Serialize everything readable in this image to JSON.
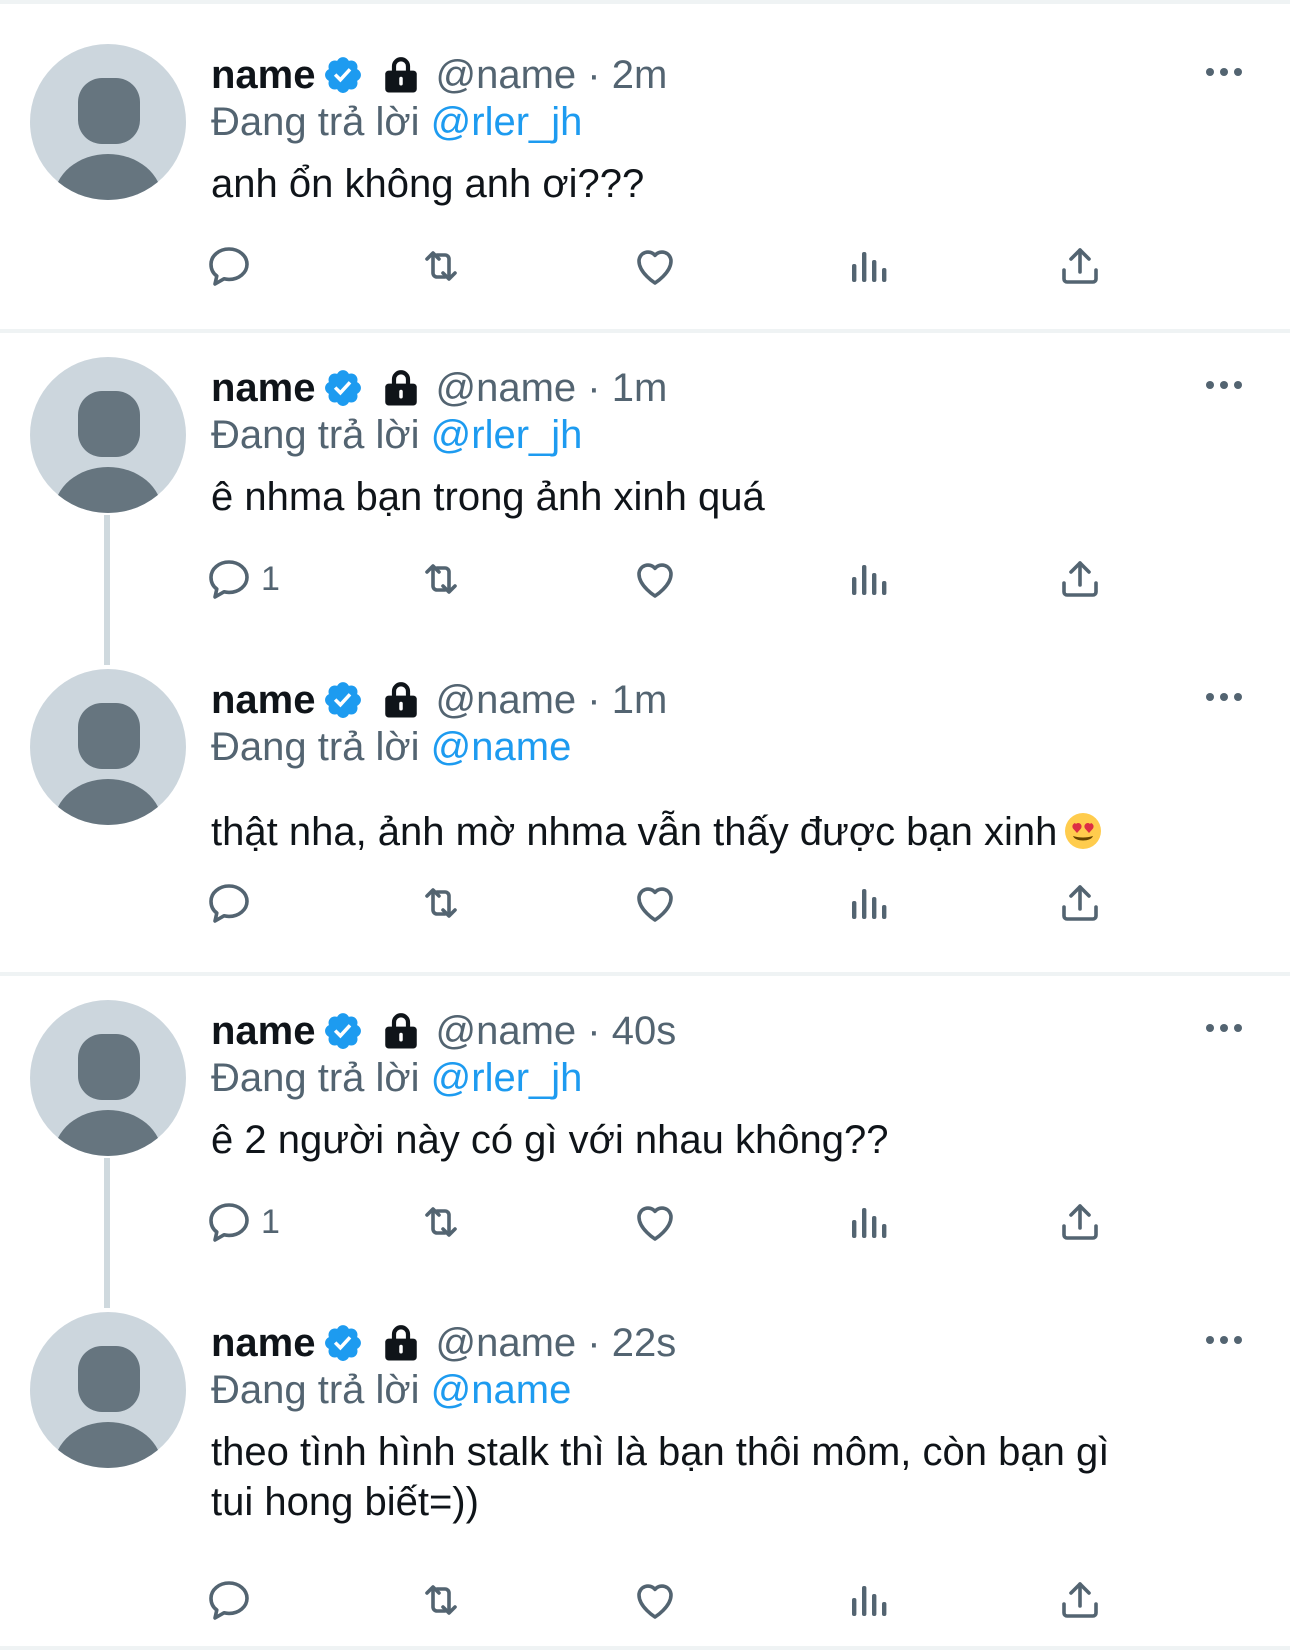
{
  "tweets": [
    {
      "name": "name",
      "handle_time": "@name · 2m",
      "reply_prefix": "Đang trả lời",
      "reply_mention": "@rler_jh",
      "text": "anh ổn không anh ơi???",
      "reply_count": ""
    },
    {
      "name": "name",
      "handle_time": "@name · 1m",
      "reply_prefix": "Đang trả lời",
      "reply_mention": "@rler_jh",
      "text": "ê nhma bạn trong ảnh xinh quá",
      "reply_count": "1"
    },
    {
      "name": "name",
      "handle_time": "@name · 1m",
      "reply_prefix": "Đang trả lời",
      "reply_mention": "@name",
      "text": "thật nha, ảnh mờ nhma vẫn thấy được bạn xinh",
      "text_emoji": "smiling-face-with-heart-eyes",
      "reply_count": ""
    },
    {
      "name": "name",
      "handle_time": "@name · 40s",
      "reply_prefix": "Đang trả lời",
      "reply_mention": "@rler_jh",
      "text": "ê 2 người này có gì với nhau không??",
      "reply_count": "1"
    },
    {
      "name": "name",
      "handle_time": "@name · 22s",
      "reply_prefix": "Đang trả lời",
      "reply_mention": "@name",
      "text_line1": "theo tình hình stalk thì là bạn thôi môm, còn bạn gì",
      "text_line2": "tui hong biết=))",
      "reply_count": ""
    }
  ],
  "icons": {
    "verified": "verified-badge-icon",
    "lock": "lock-icon",
    "more": "more-options-icon",
    "reply": "reply-icon",
    "retweet": "retweet-icon",
    "like": "like-icon",
    "views": "views-icon",
    "share": "share-icon"
  },
  "colors": {
    "accent": "#1d9bf0",
    "secondary_text": "#536471",
    "divider": "#eff3f4",
    "thread_line": "#cfd9de",
    "avatar_bg": "#ccd6dd",
    "avatar_fg": "#66757f"
  }
}
